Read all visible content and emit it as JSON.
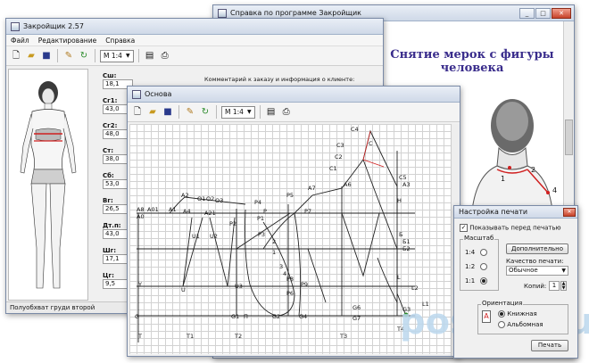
{
  "help_window": {
    "title": "Справка по программе Закройщик",
    "heading_line1": "Снятие мерок с фигуры",
    "heading_line2": "человека",
    "label_1": "1",
    "label_2": "2",
    "label_4": "4"
  },
  "main_window": {
    "title": "Закройщик 2.57",
    "menu": [
      "Файл",
      "Редактирование",
      "Справка"
    ],
    "scale": "М 1:4",
    "comment": "Комментарий к заказу и информация о клиенте:",
    "measurements": [
      {
        "label": "Сш:",
        "value": "18,1"
      },
      {
        "label": "Сг1:",
        "value": "43,0"
      },
      {
        "label": "Сг2:",
        "value": "48,0"
      },
      {
        "label": "Ст:",
        "value": "38,0"
      },
      {
        "label": "Сб:",
        "value": "53,0"
      },
      {
        "label": "Вг:",
        "value": "26,5"
      },
      {
        "label": "Дт.п:",
        "value": "43,0"
      },
      {
        "label": "Шг:",
        "value": "17,1"
      },
      {
        "label": "Цг:",
        "value": "9,5"
      }
    ],
    "status": "Полуобхват груди второй"
  },
  "osnova_window": {
    "title": "Основа",
    "scale": "М 1:4"
  },
  "pattern_labels": [
    "C4",
    "C3",
    "C2",
    "C1",
    "C5",
    "C",
    "A3",
    "A6",
    "A7",
    "P5",
    "P",
    "P1",
    "P2",
    "P3",
    "P4",
    "A8",
    "A0",
    "A01",
    "A2",
    "O1",
    "O2",
    "O3",
    "A21",
    "A4",
    "A1",
    "U",
    "U1",
    "U2",
    "U3",
    "П",
    "T",
    "T1",
    "T2",
    "T3",
    "P6",
    "P8",
    "P9",
    "P7",
    "G",
    "G1",
    "G2",
    "G3",
    "G4",
    "G6",
    "G7",
    "L",
    "L1",
    "L2",
    "Б",
    "Б1",
    "Б2",
    "H",
    "T4",
    "Y"
  ],
  "curve_numbers": [
    "1",
    "2",
    "3",
    "4"
  ],
  "print_dialog": {
    "title": "Настройка печати",
    "show_preview_label": "Показывать перед печатью",
    "scale_group": "Масштаб",
    "scale_options": [
      "1:4",
      "1:2",
      "1:1"
    ],
    "scale_selected": "1:1",
    "more_button": "Дополнительно",
    "quality_label": "Качество печати:",
    "quality_value": "Обычное",
    "copies_label": "Копий:",
    "copies_value": "1",
    "orientation_group": "Ориентация",
    "portrait_label": "Книжная",
    "landscape_label": "Альбомная",
    "print_button": "Печать"
  },
  "watermark": "postila.ru",
  "colors": {
    "title_gradient_top": "#e9eef6",
    "help_heading": "#3a2d8c",
    "watermark": "#bcd8ee",
    "accent_red": "#d02020"
  }
}
